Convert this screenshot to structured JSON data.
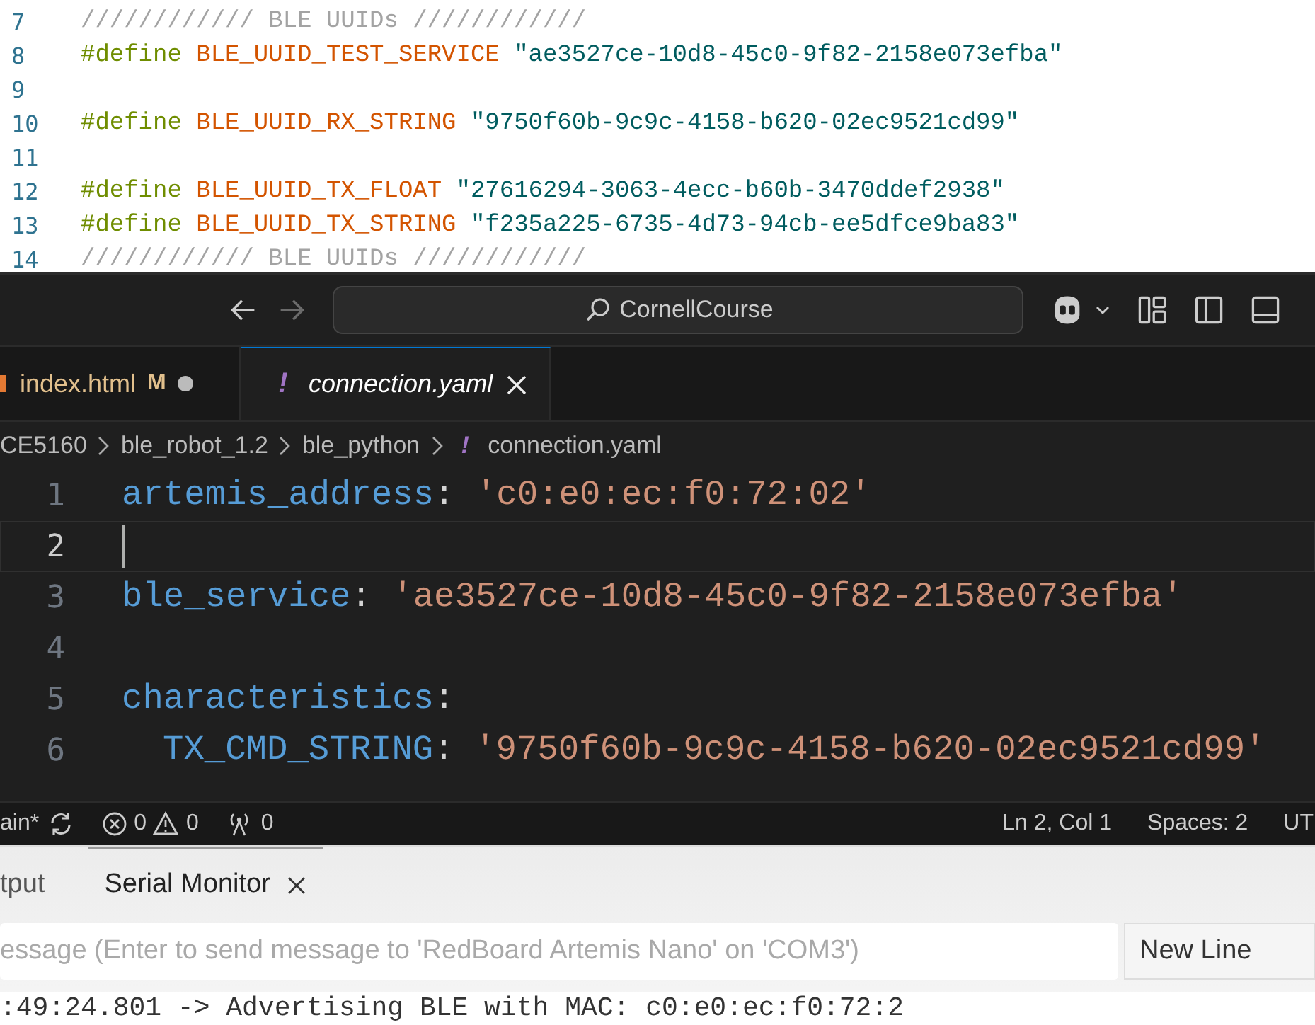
{
  "arduino_editor": {
    "lines": [
      {
        "number": "7",
        "tokens": [
          {
            "kind": "comment",
            "text": "//////////// BLE UUIDs ////////////"
          }
        ]
      },
      {
        "number": "8",
        "tokens": [
          {
            "kind": "directive",
            "text": "#define "
          },
          {
            "kind": "macro",
            "text": "BLE_UUID_TEST_SERVICE "
          },
          {
            "kind": "string",
            "text": "\"ae3527ce-10d8-45c0-9f82-2158e073efba\""
          }
        ]
      },
      {
        "number": "9"
      },
      {
        "number": "10",
        "tokens": [
          {
            "kind": "directive",
            "text": "#define "
          },
          {
            "kind": "macro",
            "text": "BLE_UUID_RX_STRING "
          },
          {
            "kind": "string",
            "text": "\"9750f60b-9c9c-4158-b620-02ec9521cd99\""
          }
        ]
      },
      {
        "number": "11"
      },
      {
        "number": "12",
        "tokens": [
          {
            "kind": "directive",
            "text": "#define "
          },
          {
            "kind": "macro",
            "text": "BLE_UUID_TX_FLOAT "
          },
          {
            "kind": "string",
            "text": "\"27616294-3063-4ecc-b60b-3470ddef2938\""
          }
        ]
      },
      {
        "number": "13",
        "tokens": [
          {
            "kind": "directive",
            "text": "#define "
          },
          {
            "kind": "macro",
            "text": "BLE_UUID_TX_STRING "
          },
          {
            "kind": "string",
            "text": "\"f235a225-6735-4d73-94cb-ee5dfce9ba83\""
          }
        ]
      },
      {
        "number": "14",
        "tokens": [
          {
            "kind": "comment",
            "text": "//////////// BLE UUIDs ////////////"
          }
        ]
      }
    ]
  },
  "vscode": {
    "title_bar": {
      "back_disabled": false,
      "forward_disabled": true,
      "search": "CornellCourse"
    },
    "tabs": [
      {
        "kind": "html",
        "label": "index.html",
        "badge": "M",
        "italic": false,
        "selected": false,
        "modified": true
      },
      {
        "kind": "yaml",
        "glyph": "!",
        "label": "connection.yaml",
        "italic": true,
        "selected": true,
        "modified": false
      }
    ],
    "breadcrumb": [
      {
        "label": "CE5160"
      },
      {
        "label": "ble_robot_1.2"
      },
      {
        "label": "ble_python"
      },
      {
        "glyph": "!",
        "label": "connection.yaml"
      }
    ],
    "lines": [
      {
        "number": "1",
        "current": false,
        "tokens": [
          {
            "kind": "key",
            "text": "artemis_address"
          },
          {
            "kind": "punct",
            "text": ": "
          },
          {
            "kind": "string",
            "text": "'c0:e0:ec:f0:72:02'"
          }
        ]
      },
      {
        "number": "2",
        "current": true
      },
      {
        "number": "3",
        "current": false,
        "tokens": [
          {
            "kind": "key",
            "text": "ble_service"
          },
          {
            "kind": "punct",
            "text": ": "
          },
          {
            "kind": "string",
            "text": "'ae3527ce-10d8-45c0-9f82-2158e073efba'"
          }
        ]
      },
      {
        "number": "4",
        "current": false
      },
      {
        "number": "5",
        "current": false,
        "tokens": [
          {
            "kind": "key",
            "text": "characteristics"
          },
          {
            "kind": "punct",
            "text": ":"
          }
        ]
      },
      {
        "number": "6",
        "current": false,
        "indented": true,
        "tokens": [
          {
            "kind": "key",
            "text": "TX_CMD_STRING"
          },
          {
            "kind": "punct",
            "text": ": "
          },
          {
            "kind": "string",
            "text": "'9750f60b-9c9c-4158-b620-02ec9521cd99'"
          }
        ]
      }
    ],
    "status_bar": {
      "branch": "ain*",
      "errors": "0",
      "warnings": "0",
      "ports": "0",
      "position": "Ln 2, Col 1",
      "indent": "Spaces: 2",
      "encoding": "UT"
    }
  },
  "serial_panel": {
    "tabs": [
      {
        "label": "tput",
        "selected": false,
        "closable": false
      },
      {
        "label": "Serial Monitor",
        "selected": true,
        "closable": true
      }
    ],
    "message_field": {
      "placeholder": "essage (Enter to send message to 'RedBoard Artemis Nano' on 'COM3')"
    },
    "line_ending": "New Line",
    "output": [
      ":49:24.801 -> Advertising BLE with MAC: c0:e0:ec:f0:72:2"
    ]
  }
}
